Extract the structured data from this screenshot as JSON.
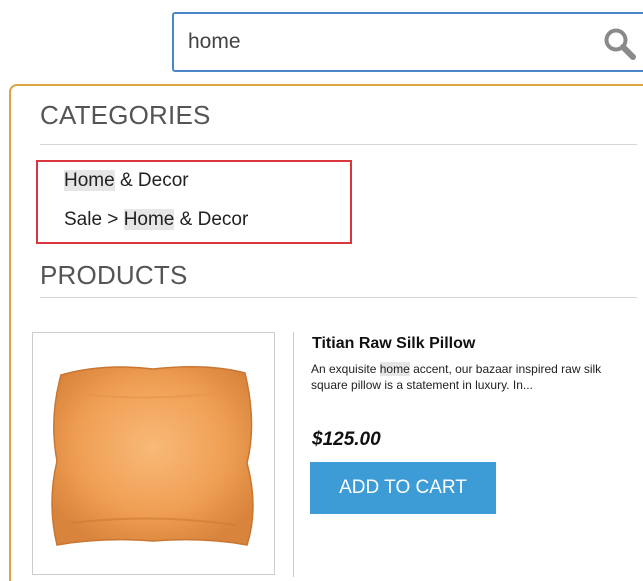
{
  "search": {
    "value": "home"
  },
  "dropdown": {
    "categories_heading": "CATEGORIES",
    "categories": [
      {
        "highlight": "Home",
        "rest": " & Decor"
      },
      {
        "prefix": "Sale > ",
        "highlight": "Home",
        "rest": " & Decor"
      }
    ],
    "products_heading": "PRODUCTS",
    "product": {
      "name": "Titian Raw Silk Pillow",
      "desc_before": "An exquisite ",
      "desc_highlight": "home",
      "desc_after": " accent, our bazaar inspired raw silk square pillow is a statement in luxury. In...",
      "price": "$125.00",
      "add_to_cart_label": "ADD TO CART"
    }
  },
  "colors": {
    "search_border": "#4a86c8",
    "dropdown_border": "#d9a441",
    "highlight_box": "#d9363e",
    "button_bg": "#3d9bd6",
    "pillow": "#f0a055"
  },
  "icons": {
    "search": "search-icon",
    "product_image": "pillow-image"
  }
}
